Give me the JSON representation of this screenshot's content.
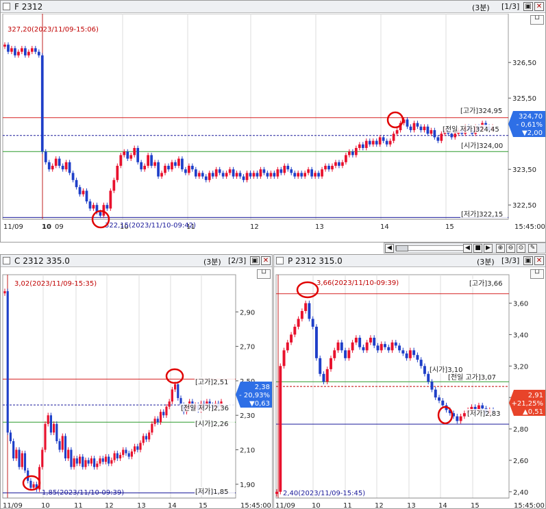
{
  "colors": {
    "up": "#e8112d",
    "down": "#1f3fc8",
    "prev_high": "#c00000",
    "low_line": "#1a1a9a",
    "open_line": "#2a9a2a",
    "circle": "#e00000",
    "cur_blue": "#2e6fe6",
    "cur_red": "#e8442a"
  },
  "icons": {
    "checkbox": "checkbox-icon",
    "restore": "restore-window-icon",
    "close": "close-icon",
    "lineview": "line-view-icon"
  },
  "futures": {
    "title": "F 2312",
    "interval": "(3분)",
    "page": "[1/3]",
    "lineview_label": "└┘",
    "axis_labels": [
      "326,50",
      "325,50",
      "323,50",
      "322,50"
    ],
    "date_labels": [
      "11/09",
      "10",
      "09",
      "10",
      "11",
      "12",
      "13",
      "14",
      "15",
      "15:45:00"
    ],
    "ann_high": "327,20(2023/11/09-15:06)",
    "ann_low": "322,15(2023/11/10-09:42)",
    "label_high": "[고가]324,95",
    "label_prev": "[전일 저가]324,45",
    "label_open": "[시가]324,00",
    "label_low": "[저가]322,15",
    "current": {
      "price": "324,70",
      "pct": "- 0,61%",
      "chg": "▼2,00"
    }
  },
  "call": {
    "title": "C 2312 335.0",
    "interval": "(3분)",
    "page": "[2/3]",
    "lineview_label": "└┘",
    "axis_labels": [
      "2,90",
      "2,70",
      "2,50",
      "2,30",
      "2,10",
      "1,90"
    ],
    "date_labels": [
      "11/09",
      "10",
      "11",
      "12",
      "13",
      "14",
      "15",
      "15:45:00"
    ],
    "ann_high": "3,02(2023/11/09-15:35)",
    "ann_low": "1,85(2023/11/10-09:39)",
    "label_high": "[고가]2,51",
    "label_prev": "[전일 저가]2,36",
    "label_open": "[시가]2,26",
    "label_low": "[저가]1,85",
    "current": {
      "price": "2,38",
      "pct": "- 20,93%",
      "chg": "▼0,63"
    }
  },
  "put": {
    "title": "P 2312 315.0",
    "interval": "(3분)",
    "page": "[3/3]",
    "lineview_label": "└┘",
    "axis_labels": [
      "3,60",
      "3,40",
      "3,20",
      "3,00",
      "2,80",
      "2,60",
      "2,40"
    ],
    "date_labels": [
      "11/09",
      "10",
      "11",
      "12",
      "13",
      "14",
      "15",
      "15:45:00"
    ],
    "ann_high": "3,66(2023/11/10-09:39)",
    "ann_low": "2,40(2023/11/09-15:45)",
    "label_high": "[고가]3,66",
    "label_open": "[시가]3,10",
    "label_prev": "[전일 고가]3,07",
    "label_low": "[저가]2,83",
    "current": {
      "price": "2,91",
      "pct": "+21,25%",
      "chg": "▲0,51"
    }
  },
  "chart_data": [
    {
      "type": "candlestick",
      "name": "F 2312",
      "ylim": [
        322.1,
        327.6
      ],
      "reference_lines": {
        "high": 324.95,
        "prev_low": 324.45,
        "open": 324.0,
        "low": 322.15
      },
      "closes": [
        327.0,
        326.8,
        326.9,
        326.7,
        326.8,
        326.9,
        326.7,
        326.8,
        326.9,
        326.8,
        326.7,
        324.0,
        323.7,
        323.5,
        323.6,
        323.8,
        323.6,
        323.5,
        323.7,
        323.4,
        323.2,
        323.0,
        322.8,
        322.9,
        322.6,
        322.4,
        322.5,
        322.3,
        322.2,
        322.5,
        322.4,
        322.9,
        323.2,
        323.6,
        323.9,
        324.0,
        323.8,
        323.9,
        324.1,
        323.7,
        323.5,
        323.6,
        323.9,
        323.6,
        323.7,
        323.3,
        323.4,
        323.6,
        323.5,
        323.7,
        323.6,
        323.8,
        323.5,
        323.4,
        323.6,
        323.5,
        323.3,
        323.4,
        323.3,
        323.2,
        323.4,
        323.3,
        323.5,
        323.4,
        323.3,
        323.4,
        323.5,
        323.3,
        323.4,
        323.3,
        323.2,
        323.4,
        323.3,
        323.4,
        323.3,
        323.5,
        323.4,
        323.3,
        323.4,
        323.3,
        323.5,
        323.4,
        323.6,
        323.5,
        323.4,
        323.3,
        323.4,
        323.3,
        323.4,
        323.5,
        323.3,
        323.4,
        323.3,
        323.5,
        323.6,
        323.5,
        323.6,
        323.7,
        323.6,
        323.7,
        323.9,
        324.0,
        323.9,
        324.1,
        324.2,
        324.1,
        324.3,
        324.2,
        324.3,
        324.2,
        324.4,
        324.3,
        324.2,
        324.3,
        324.5,
        324.6,
        324.8,
        324.9,
        324.7,
        324.6,
        324.8,
        324.7,
        324.6,
        324.7,
        324.5,
        324.6,
        324.4,
        324.3,
        324.5,
        324.6,
        324.5,
        324.4,
        324.5,
        324.6,
        324.5,
        324.7,
        324.6,
        324.5,
        324.7,
        324.6,
        324.8,
        324.7,
        324.6,
        324.7
      ]
    },
    {
      "type": "candlestick",
      "name": "C 2312 335.0",
      "ylim": [
        1.82,
        3.06
      ],
      "reference_lines": {
        "high": 2.51,
        "prev_low": 2.36,
        "open": 2.26,
        "low": 1.85
      },
      "closes": [
        3.02,
        2.2,
        2.15,
        2.05,
        2.1,
        2.0,
        2.08,
        1.98,
        1.92,
        1.88,
        1.9,
        1.87,
        2.0,
        2.1,
        2.25,
        2.3,
        2.2,
        2.25,
        2.15,
        2.1,
        2.18,
        2.05,
        2.1,
        2.0,
        2.05,
        2.02,
        2.06,
        2.0,
        2.04,
        2.02,
        2.05,
        2.0,
        2.02,
        2.05,
        2.03,
        2.06,
        2.02,
        2.04,
        2.08,
        2.05,
        2.07,
        2.1,
        2.08,
        2.06,
        2.09,
        2.12,
        2.1,
        2.14,
        2.18,
        2.16,
        2.2,
        2.25,
        2.28,
        2.26,
        2.32,
        2.3,
        2.35,
        2.38,
        2.45,
        2.48,
        2.4,
        2.36,
        2.32,
        2.35,
        2.38,
        2.34,
        2.36,
        2.33,
        2.37,
        2.35,
        2.38,
        2.36,
        2.34,
        2.37,
        2.35,
        2.38
      ]
    },
    {
      "type": "candlestick",
      "name": "P 2312 315.0",
      "ylim": [
        2.36,
        3.72
      ],
      "reference_lines": {
        "high": 3.66,
        "open": 3.1,
        "prev_high": 3.07,
        "low": 2.83
      },
      "closes": [
        2.4,
        3.2,
        3.3,
        3.35,
        3.4,
        3.45,
        3.5,
        3.55,
        3.6,
        3.5,
        3.45,
        3.25,
        3.15,
        3.1,
        3.18,
        3.25,
        3.3,
        3.35,
        3.3,
        3.25,
        3.3,
        3.35,
        3.38,
        3.32,
        3.3,
        3.35,
        3.38,
        3.33,
        3.3,
        3.34,
        3.32,
        3.3,
        3.35,
        3.33,
        3.3,
        3.28,
        3.25,
        3.3,
        3.27,
        3.24,
        3.2,
        3.15,
        3.1,
        3.05,
        3.0,
        2.98,
        2.95,
        2.92,
        2.9,
        2.88,
        2.85,
        2.88,
        2.9,
        2.92,
        2.94,
        2.92,
        2.95,
        2.93,
        2.9,
        2.92,
        2.91
      ]
    }
  ]
}
